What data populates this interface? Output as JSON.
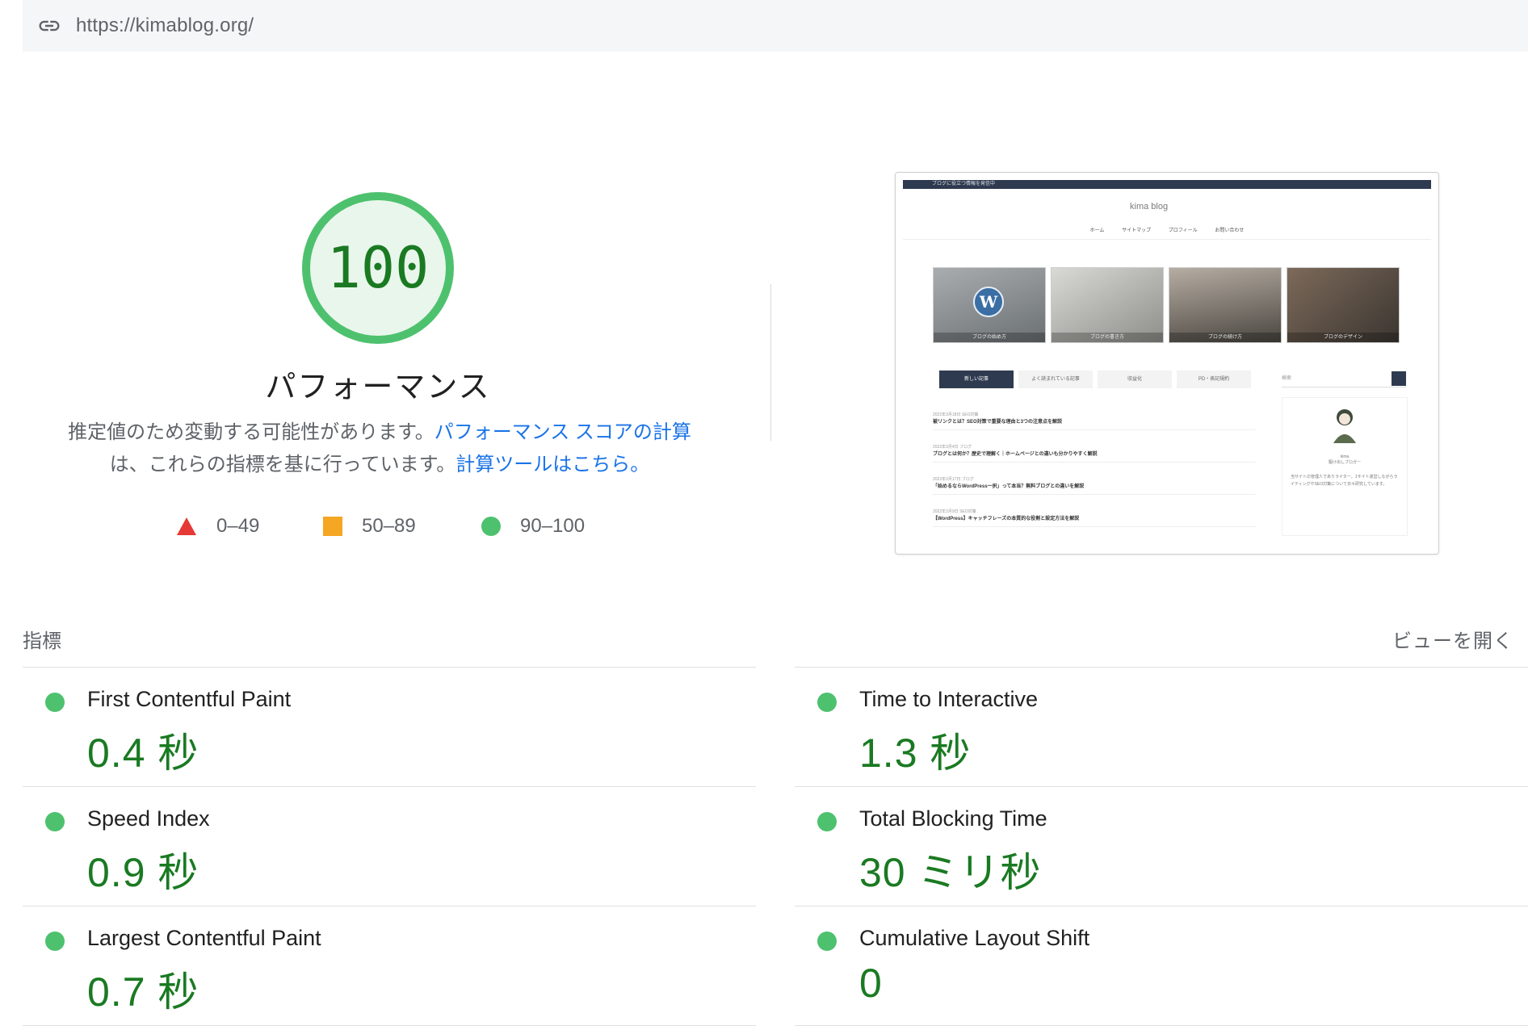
{
  "url_bar": {
    "url": "https://kimablog.org/",
    "icon": "link-icon"
  },
  "score": {
    "value": 100,
    "value_text": "100",
    "fraction": 1.0,
    "title": "パフォーマンス",
    "description_prefix": "推定値のため変動する可能性があります。",
    "description_link1": "パフォーマンス スコアの計算",
    "description_middle": "は、これらの指標を基に行っています。",
    "description_link2": "計算ツールはこちら。",
    "colors": {
      "pass": "#0cce6b",
      "pass_text": "#1a7a22",
      "gauge_fill": "#e9f6ec",
      "average": "#ffa400",
      "fail": "#ff4e42"
    }
  },
  "legend": [
    {
      "shape": "triangle",
      "range": "0–49",
      "color": "#e53935"
    },
    {
      "shape": "square",
      "range": "50–89",
      "color": "#f5a623"
    },
    {
      "shape": "circle",
      "range": "90–100",
      "color": "#4ec16e"
    }
  ],
  "thumbnail": {
    "topbar_text": "ブログに役立つ情報を発信中",
    "logo": "kima blog",
    "nav": [
      "ホーム",
      "サイトマップ",
      "プロフィール",
      "お問い合わせ"
    ],
    "tiles": [
      "ブログの始め方",
      "ブログの書き方",
      "ブログの続け方",
      "ブログのデザイン"
    ],
    "tabs": [
      "新しい記事",
      "よく読まれている記事",
      "収益化",
      "PD・表記規約"
    ],
    "search_placeholder": "検索",
    "posts": [
      {
        "meta": "2022年3月18日 SEO対策",
        "title": "被リンクとは？SEO対策で重要な理由と3つの注意点を解説"
      },
      {
        "meta": "2022年3月4日 ブログ",
        "title": "ブログとは何か？歴史で理解く｜ホームページとの違いも分かりやすく解説"
      },
      {
        "meta": "2022年2月17日 ブログ",
        "title": "「始めるならWordPress一択」って本当？無料ブログとの違いを解説"
      },
      {
        "meta": "2022年2月9日 SEO対策",
        "title": "【WordPress】キャッチフレーズの本質的な役割と設定方法を解説"
      }
    ],
    "side_name": "kima",
    "side_role": "駆け出しブロガー",
    "side_bio": "当サイトの管理人でありライター。1サイト運営しながらライティングやSEO対策について日々研究しています。"
  },
  "metrics_section": {
    "label": "指標",
    "open_view": "ビューを開く"
  },
  "metrics": [
    {
      "name": "First Contentful Paint",
      "value": "0.4 秒",
      "status": "pass"
    },
    {
      "name": "Time to Interactive",
      "value": "1.3 秒",
      "status": "pass"
    },
    {
      "name": "Speed Index",
      "value": "0.9 秒",
      "status": "pass"
    },
    {
      "name": "Total Blocking Time",
      "value": "30 ミリ秒",
      "status": "pass"
    },
    {
      "name": "Largest Contentful Paint",
      "value": "0.7 秒",
      "status": "pass"
    },
    {
      "name": "Cumulative Layout Shift",
      "value": "0",
      "status": "pass"
    }
  ]
}
